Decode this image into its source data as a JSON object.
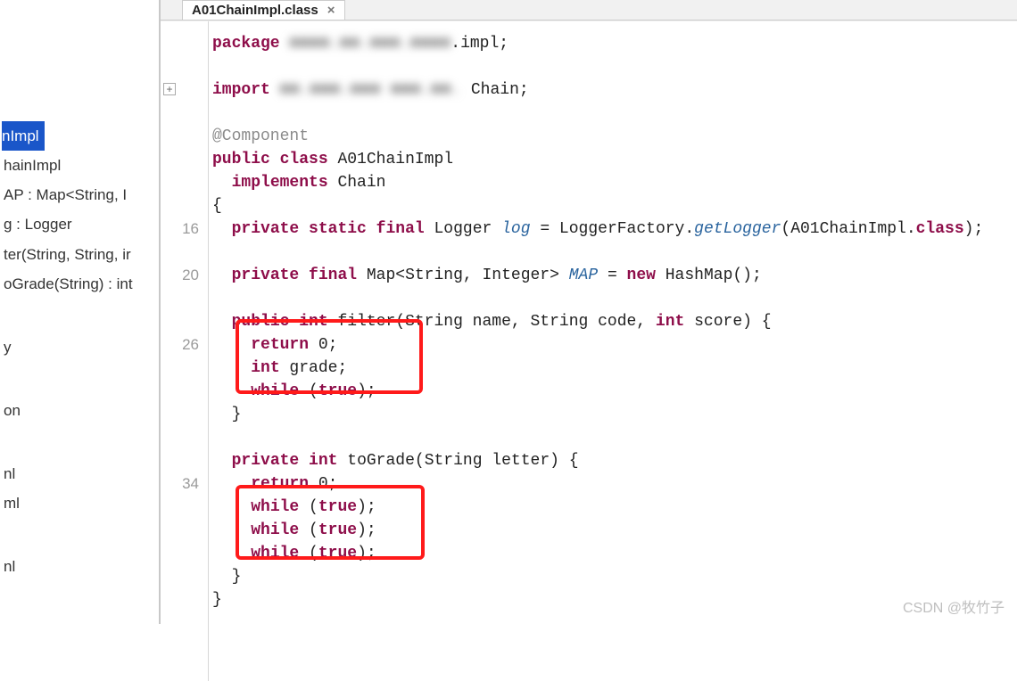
{
  "tab": {
    "title": "A01ChainImpl.class",
    "close": "×"
  },
  "sidebar": {
    "items": [
      "nImpl",
      "hainImpl",
      "AP : Map<String, I",
      "g : Logger",
      "ter(String, String, ir",
      "oGrade(String) : int",
      "",
      "y",
      "",
      "on",
      "",
      "nl",
      "ml",
      "",
      "nl"
    ]
  },
  "gutter": {
    "lines": [
      "",
      "",
      "",
      "",
      "",
      "",
      "",
      "",
      "16",
      "",
      "20",
      "",
      "",
      "26",
      "",
      "",
      "",
      "",
      "",
      "34",
      "",
      "",
      "",
      "",
      ""
    ]
  },
  "code": {
    "package_kw": "package",
    "package_redacted": "■■■■.■■.■■■.■■■■",
    "package_tail": ".impl;",
    "import_kw": "import",
    "import_redacted": "■■.■■■.■■■ ■■■.■■.",
    "import_tail": "Chain;",
    "annotation": "@Component",
    "class_decl_kw1": "public",
    "class_decl_kw2": "class",
    "class_name": "A01ChainImpl",
    "implements_kw": "implements",
    "implements_type": "Chain",
    "brace_open": "{",
    "logger_kw1": "private",
    "logger_kw2": "static",
    "logger_kw3": "final",
    "logger_type": "Logger",
    "logger_var": "log",
    "logger_rhs1": " = LoggerFactory.",
    "logger_rhs_m": "getLogger",
    "logger_rhs2": "(A01ChainImpl.",
    "logger_rhs_kw": "class",
    "logger_rhs3": ");",
    "map_kw1": "private",
    "map_kw2": "final",
    "map_type": "Map<String, Integer>",
    "map_var": "MAP",
    "map_rhs_pre": " = ",
    "map_rhs_kw": "new",
    "map_rhs_call": " HashMap();",
    "filter_kw1": "public",
    "filter_kw2": "int",
    "filter_name": "filter",
    "filter_params": "(String name, String code, ",
    "filter_params_kw": "int",
    "filter_params2": " score) {",
    "return_kw": "return",
    "return_val": " 0;",
    "int_kw": "int",
    "grade_var": " grade;",
    "while_kw": "while",
    "true_kw": "true",
    "while_stmt_open": " (",
    "while_stmt_close": ");",
    "brace_close_inner": "  }",
    "tograde_kw1": "private",
    "tograde_kw2": "int",
    "tograde_name": "toGrade",
    "tograde_params": "(String letter) {",
    "brace_close_outer": "}"
  },
  "watermark": "CSDN @牧竹子"
}
